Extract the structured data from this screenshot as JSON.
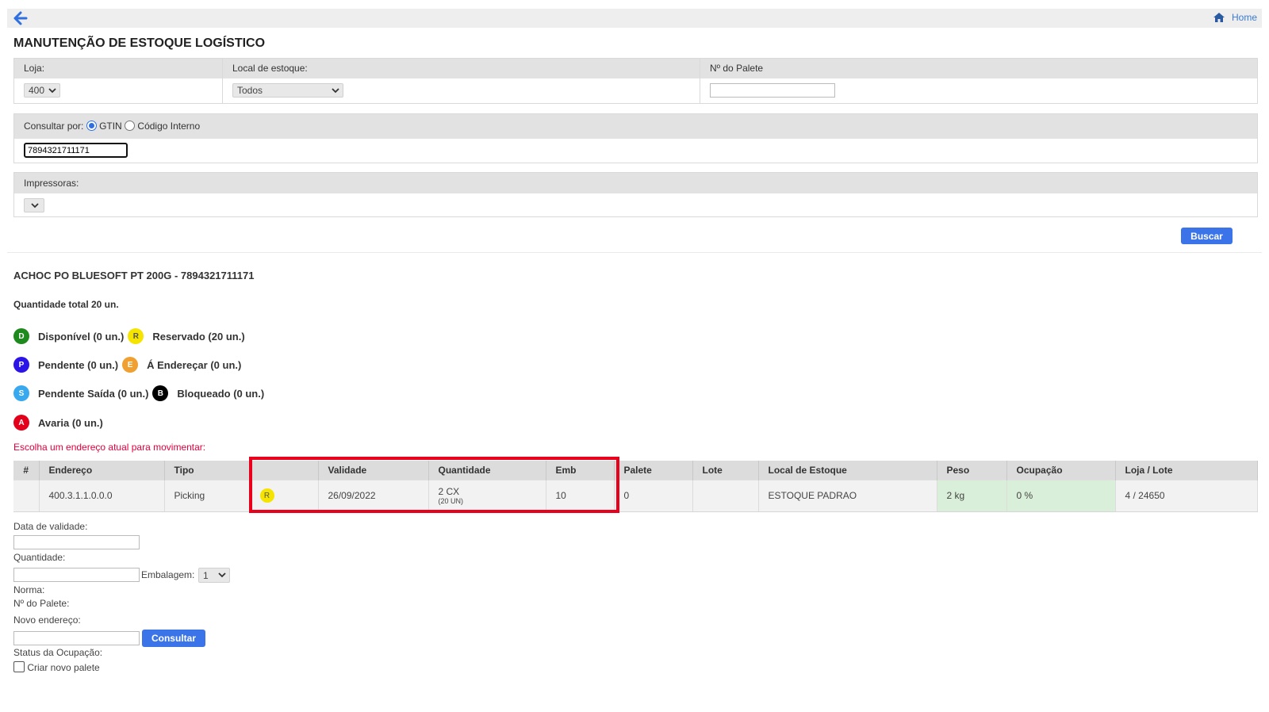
{
  "topbar": {
    "home_label": "Home"
  },
  "page_title": "MANUTENÇÃO DE ESTOQUE LOGÍSTICO",
  "filters": {
    "loja_label": "Loja:",
    "loja_value": "400",
    "local_label": "Local de estoque:",
    "local_value": "Todos",
    "palete_label": "Nº do Palete",
    "palete_value": ""
  },
  "consulta": {
    "label": "Consultar por:",
    "opt_gtin": "GTIN",
    "opt_codigo": "Código Interno",
    "value": "7894321711171"
  },
  "impressoras": {
    "label": "Impressoras:",
    "value": ""
  },
  "buscar_label": "Buscar",
  "product": {
    "title": "ACHOC PO BLUESOFT PT 200G - 7894321711171",
    "total": "Quantidade total 20 un."
  },
  "legend": [
    {
      "letter": "D",
      "color": "#1e8a1e",
      "text_color": "#ffffff",
      "label": "Disponível (0 un.)"
    },
    {
      "letter": "R",
      "color": "#f5e400",
      "text_color": "#555555",
      "label": "Reservado (20 un.)"
    },
    {
      "letter": "P",
      "color": "#2a14e6",
      "text_color": "#ffffff",
      "label": "Pendente (0 un.)"
    },
    {
      "letter": "E",
      "color": "#f0a030",
      "text_color": "#ffffff",
      "label": "Á Endereçar (0 un.)"
    },
    {
      "letter": "S",
      "color": "#38a8ef",
      "text_color": "#ffffff",
      "label": "Pendente Saída (0 un.)"
    },
    {
      "letter": "B",
      "color": "#000000",
      "text_color": "#ffffff",
      "label": "Bloqueado (0 un.)"
    },
    {
      "letter": "A",
      "color": "#e3001b",
      "text_color": "#ffffff",
      "label": "Avaria (0 un.)"
    }
  ],
  "escolha_label": "Escolha um endereço atual para movimentar:",
  "table": {
    "headers": [
      "#",
      "Endereço",
      "Tipo",
      "",
      "Validade",
      "Quantidade",
      "Emb",
      "Palete",
      "Lote",
      "Local de Estoque",
      "Peso",
      "Ocupação",
      "Loja / Lote"
    ],
    "row": {
      "num": "",
      "endereco": "400.3.1.1.0.0.0",
      "tipo": "Picking",
      "status_letter": "R",
      "validade": "26/09/2022",
      "quantidade": "2 CX",
      "quantidade_sub": "(20 UN)",
      "emb": "10",
      "palete": "0",
      "lote": "",
      "local": "ESTOQUE PADRAO",
      "peso": "2 kg",
      "ocupacao": "0 %",
      "loja_lote": "4 / 24650"
    }
  },
  "form": {
    "data_validade_label": "Data de validade:",
    "quantidade_label": "Quantidade:",
    "embalagem_label": "Embalagem:",
    "embalagem_value": "1",
    "norma_label": "Norma:",
    "palete_label": "Nº do Palete:",
    "novo_endereco_label": "Novo endereço:",
    "consultar_label": "Consultar",
    "status_label": "Status da Ocupação:",
    "criar_palete_label": "Criar novo palete"
  }
}
